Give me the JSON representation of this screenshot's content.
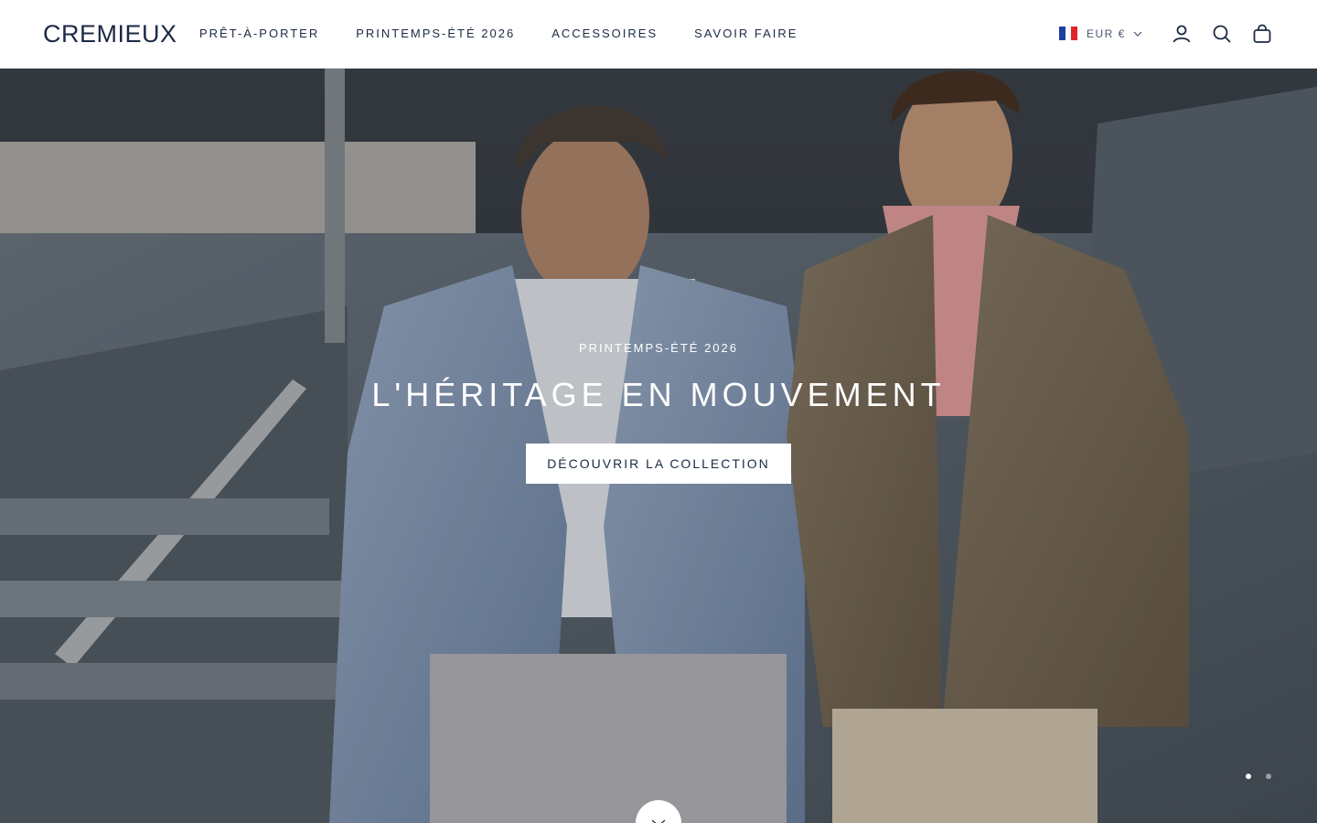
{
  "brand": {
    "logo": "CREMIEUX"
  },
  "nav": {
    "items": [
      {
        "label": "PRÊT-À-PORTER"
      },
      {
        "label": "PRINTEMPS-ÉTÉ 2026"
      },
      {
        "label": "ACCESSOIRES"
      },
      {
        "label": "SAVOIR FAIRE"
      }
    ]
  },
  "header_tools": {
    "currency": "EUR €",
    "flag_colors": [
      "#1f3fa0",
      "#ffffff",
      "#e1232c"
    ],
    "icons": [
      "account-icon",
      "search-icon",
      "bag-icon"
    ]
  },
  "hero": {
    "eyebrow": "PRINTEMPS-ÉTÉ 2026",
    "headline": "L'HÉRITAGE EN MOUVEMENT",
    "cta_label": "DÉCOUVRIR LA COLLECTION",
    "slides": {
      "count": 2,
      "active": 1
    },
    "active_dot_color": "#ffffff",
    "inactive_dot_color": "#9aa0a8"
  }
}
